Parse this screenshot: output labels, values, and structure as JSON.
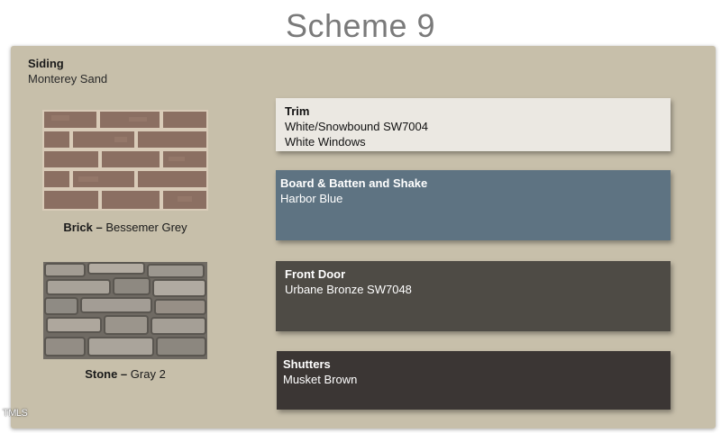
{
  "title": "Scheme 9",
  "siding": {
    "label": "Siding",
    "value": "Monterey Sand"
  },
  "brick": {
    "label": "Brick –",
    "value": " Bessemer Grey"
  },
  "stone": {
    "label": "Stone –",
    "value": " Gray 2"
  },
  "trim": {
    "label": "Trim",
    "line1": "White/Snowbound SW7004",
    "line2": "White Windows",
    "color": "#ebe8e2"
  },
  "board": {
    "label": "Board & Batten and Shake",
    "line1": "Harbor Blue",
    "color": "#5e7382"
  },
  "door": {
    "label": "Front Door",
    "line1": "Urbane Bronze SW7048",
    "color": "#4e4b45"
  },
  "shutters": {
    "label": "Shutters",
    "line1": "Musket Brown",
    "color": "#3b3634"
  },
  "watermark": "TMLS",
  "panel_color": "#c7bfaa"
}
